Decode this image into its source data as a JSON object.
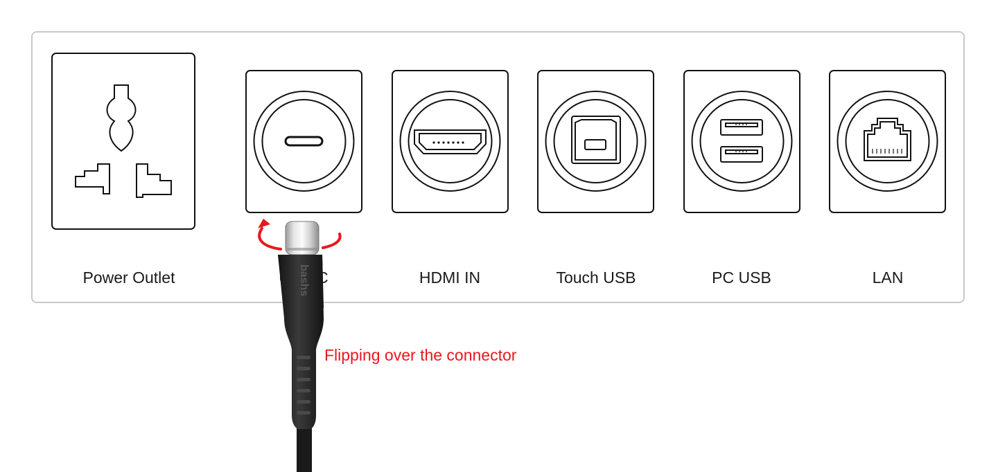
{
  "ports": [
    {
      "name": "power-outlet",
      "label": "Power Outlet"
    },
    {
      "name": "usb-c",
      "label": "USB-C"
    },
    {
      "name": "hdmi-in",
      "label": "HDMI IN"
    },
    {
      "name": "touch-usb",
      "label": "Touch USB"
    },
    {
      "name": "pc-usb",
      "label": "PC USB"
    },
    {
      "name": "lan",
      "label": "LAN"
    }
  ],
  "annotation": {
    "text": "Flipping over the connector",
    "color": "#e8171f"
  },
  "cable_brand": "bashs"
}
